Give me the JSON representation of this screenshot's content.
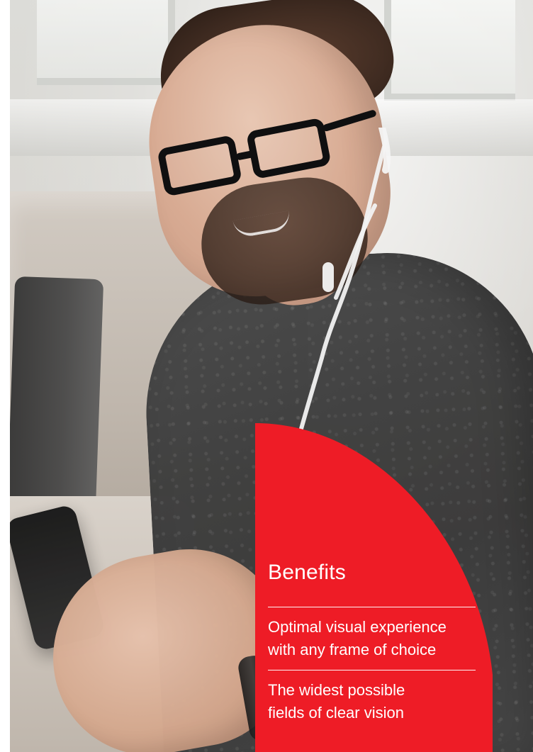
{
  "colors": {
    "accent_red": "#EE1C26",
    "text_on_red": "#FFFFFF"
  },
  "benefits": {
    "title": "Benefits",
    "items": [
      {
        "lines": [
          "Optimal visual experience",
          "with any frame of choice"
        ]
      },
      {
        "lines": [
          "The widest possible",
          "fields of clear vision"
        ]
      }
    ]
  }
}
